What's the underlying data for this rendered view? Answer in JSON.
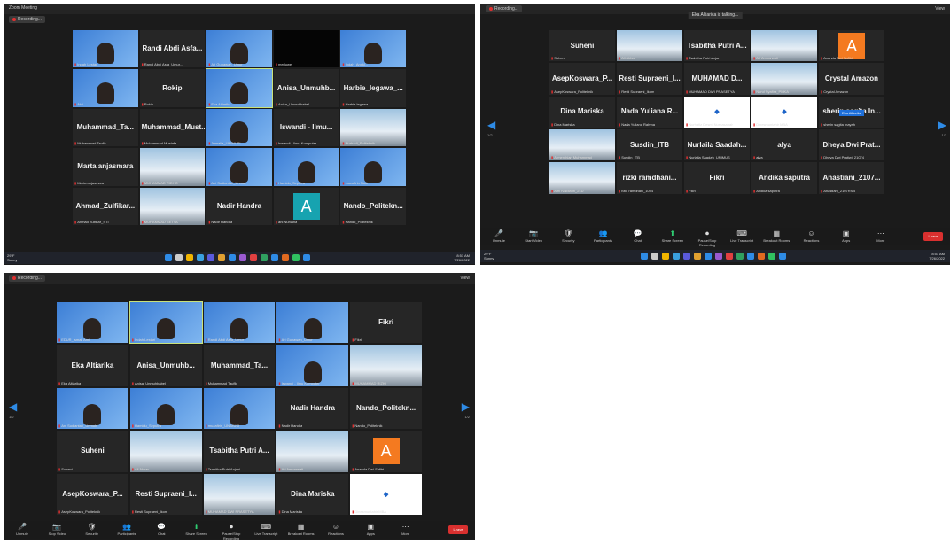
{
  "colors": {
    "accent": "#2e8be6",
    "record": "#e03030",
    "leave": "#d9302f",
    "avatar_orange": "#f47a20",
    "avatar_teal": "#17a3b0"
  },
  "screens": {
    "s1": {
      "window_title": "Zoom Meeting",
      "recording_label": "Recording...",
      "tiles": [
        {
          "name": "",
          "label": "Indah Lestari",
          "kind": "vid"
        },
        {
          "name": "Randi Abdi Asfa...",
          "label": "Randi Abdi Asfa_Umur...",
          "kind": "name"
        },
        {
          "name": "",
          "label": "Ari Gunawan_Umur",
          "kind": "vid"
        },
        {
          "name": "",
          "label": "meduwer",
          "kind": "black"
        },
        {
          "name": "",
          "label": "Indah_Angkl...",
          "kind": "vid"
        },
        {
          "name": "",
          "label": "Alvi",
          "kind": "vid"
        },
        {
          "name": "Rokip",
          "label": "Rokip",
          "kind": "name"
        },
        {
          "name": "",
          "label": "Eka Altiarika",
          "kind": "vid",
          "hl": true
        },
        {
          "name": "Anisa_Unmuhb...",
          "label": "Anisa_Unmuhbabel",
          "kind": "name"
        },
        {
          "name": "Harbie_legawa_...",
          "label": "Harbie legawa",
          "kind": "name"
        },
        {
          "name": "Muhammad_Ta...",
          "label": "Muhammad Taufik",
          "kind": "name"
        },
        {
          "name": "Muhammad_Must...",
          "label": "Muhammad Mustafa",
          "kind": "name"
        },
        {
          "name": "",
          "label": "Jurnalia_UNIMUSI",
          "kind": "vid"
        },
        {
          "name": "Iswandi - Ilmu...",
          "label": "Iswandi - Ilmu Komputer",
          "kind": "name"
        },
        {
          "name": "",
          "label": "Nurhadi_Politeknik",
          "kind": "photo"
        },
        {
          "name": "Marta anjasmara",
          "label": "Marta anjasmara",
          "kind": "name"
        },
        {
          "name": "",
          "label": "MUHAMMAD RIDHO",
          "kind": "photo"
        },
        {
          "name": "",
          "label": "Ani Sudiantari_Unmuh",
          "kind": "vid"
        },
        {
          "name": "",
          "label": "Hamidu_Seputra",
          "kind": "vid"
        },
        {
          "name": "",
          "label": "muzafirin Noor",
          "kind": "vid"
        },
        {
          "name": "Ahmad_Zulfikar...",
          "label": "Ahmad Zulfikar_STI",
          "kind": "name"
        },
        {
          "name": "",
          "label": "MUHAMMAD SETYA",
          "kind": "photo"
        },
        {
          "name": "Nadir Handra",
          "label": "Nadir Handra",
          "kind": "name"
        },
        {
          "name": "A",
          "label": "ani Nurliana",
          "kind": "avatar_teal"
        },
        {
          "name": "Nando_Politekn...",
          "label": "Nando_Politeknik",
          "kind": "name"
        }
      ],
      "weather": {
        "temp": "29°F",
        "desc": "Sunny"
      },
      "clock": {
        "time": "8:51 AM",
        "date": "7/26/2022"
      }
    },
    "s2": {
      "recording_label": "Recording...",
      "title": "Eka Altiarika is talking...",
      "view_label": "View",
      "page": "1/2",
      "chip": "Eka Altiarika",
      "tiles": [
        {
          "name": "Suheni",
          "label": "Suheni",
          "kind": "name"
        },
        {
          "name": "",
          "label": "Ali Akbar",
          "kind": "photo"
        },
        {
          "name": "Tsabitha Putri A...",
          "label": "Tsabitha Putri Anjani",
          "kind": "name"
        },
        {
          "name": "",
          "label": "Ari Ambarwati",
          "kind": "photo"
        },
        {
          "name": "A",
          "label": "Ananda Dwi Safitri",
          "kind": "avatar_orange"
        },
        {
          "name": "AsepKoswara_P...",
          "label": "AsepKoswara_Politeknik",
          "kind": "name"
        },
        {
          "name": "Resti Supraeni_I...",
          "label": "Resti Supraeni_Ikom",
          "kind": "name"
        },
        {
          "name": "MUHAMAD D...",
          "label": "MUHAMAD DWI PRASETYA",
          "kind": "name"
        },
        {
          "name": "",
          "label": "Nurul Syafira_PMKA",
          "kind": "photo"
        },
        {
          "name": "Crystal Amazon",
          "label": "Crystal Amazon",
          "kind": "name"
        },
        {
          "name": "Dina Mariska",
          "label": "Dina Mariska",
          "kind": "name"
        },
        {
          "name": "Nada Yuliana R...",
          "label": "Nada Yuliana Rahma",
          "kind": "name"
        },
        {
          "name": "",
          "label": "Nurhafiz Desmi Nurhasanah",
          "kind": "logo"
        },
        {
          "name": "",
          "label": "Dinesmuntahir MBA",
          "kind": "logo"
        },
        {
          "name": "sherin sagita In...",
          "label": "sherin sagita Inayah",
          "kind": "name"
        },
        {
          "name": "",
          "label": "Armenthian Muhammad",
          "kind": "photo"
        },
        {
          "name": "Susdin_ITB",
          "label": "Susdin_ITB",
          "kind": "name"
        },
        {
          "name": "Nurlaila Saadah...",
          "label": "Nurlaila Saadah_UNIMUS",
          "kind": "name"
        },
        {
          "name": "alya",
          "label": "alya",
          "kind": "name"
        },
        {
          "name": "Dheya Dwi Prat...",
          "label": "Dheya Dwi Pratiwi_21074",
          "kind": "name"
        },
        {
          "name": "",
          "label": "Ami Ivaldianti_21D",
          "kind": "photo"
        },
        {
          "name": "rizki ramdhani...",
          "label": "rizki ramdhani_1004",
          "kind": "name"
        },
        {
          "name": "Fikri",
          "label": "Fikri",
          "kind": "name"
        },
        {
          "name": "Andika saputra",
          "label": "Andika saputra",
          "kind": "name"
        },
        {
          "name": "Anastiani_2107...",
          "label": "Anastiani_2107RSB",
          "kind": "name"
        }
      ],
      "toolbar": [
        "Unmute",
        "Start Video",
        "Security",
        "Participants",
        "Chat",
        "Share Screen",
        "Pause/Stop Recording",
        "Live Transcript",
        "Breakout Rooms",
        "Reactions",
        "Apps",
        "More"
      ],
      "leave": "Leave",
      "weather": {
        "temp": "29°F",
        "desc": "Sunny"
      },
      "clock": {
        "time": "8:51 AM",
        "date": "7/26/2022"
      }
    },
    "s3": {
      "recording_label": "Recording...",
      "view_label": "View",
      "page": "1/2",
      "tiles": [
        {
          "name": "",
          "label": "EDUR_Ismail Amir",
          "kind": "vid"
        },
        {
          "name": "",
          "label": "Indah Lestari",
          "kind": "vid",
          "hl": true
        },
        {
          "name": "",
          "label": "Randi Abdi Asfa_Umur",
          "kind": "vid"
        },
        {
          "name": "",
          "label": "Ari Gunawan_Umur",
          "kind": "vid"
        },
        {
          "name": "Fikri",
          "label": "Fikri",
          "kind": "name"
        },
        {
          "name": "Eka Altiarika",
          "label": "Eka Altiarika",
          "kind": "name"
        },
        {
          "name": "Anisa_Unmuhb...",
          "label": "Anisa_Unmuhbabel",
          "kind": "name"
        },
        {
          "name": "Muhammad_Ta...",
          "label": "Muhammad Taufik",
          "kind": "name"
        },
        {
          "name": "",
          "label": "Iswandi - Ilmu Komputer",
          "kind": "vid"
        },
        {
          "name": "",
          "label": "MUHAMMAD RIZKI",
          "kind": "photo"
        },
        {
          "name": "",
          "label": "Ani Sudiantari_Unmuh",
          "kind": "vid"
        },
        {
          "name": "",
          "label": "Hamidu_Seputra",
          "kind": "vid"
        },
        {
          "name": "",
          "label": "muzafirin_UNIMUSI",
          "kind": "vid"
        },
        {
          "name": "Nadir Handra",
          "label": "Nadir Handra",
          "kind": "name"
        },
        {
          "name": "Nando_Politekn...",
          "label": "Nando_Politeknik",
          "kind": "name"
        },
        {
          "name": "Suheni",
          "label": "Suheni",
          "kind": "name"
        },
        {
          "name": "",
          "label": "Ali Akbar",
          "kind": "photo"
        },
        {
          "name": "Tsabitha Putri A...",
          "label": "Tsabitha Putri Anjani",
          "kind": "name"
        },
        {
          "name": "",
          "label": "Ari Ambarwati",
          "kind": "photo"
        },
        {
          "name": "A",
          "label": "Ananda Dwi Safitri",
          "kind": "avatar_orange"
        },
        {
          "name": "AsepKoswara_P...",
          "label": "AsepKoswara_Politeknik",
          "kind": "name"
        },
        {
          "name": "Resti Supraeni_I...",
          "label": "Resti Supraeni_Ikom",
          "kind": "name"
        },
        {
          "name": "",
          "label": "MUHAMAD DWI PRASETYA",
          "kind": "photo"
        },
        {
          "name": "Dina Mariska",
          "label": "Dina Mariska",
          "kind": "name"
        },
        {
          "name": "",
          "label": "Dinesmuntahir MBA",
          "kind": "logo"
        }
      ],
      "toolbar": [
        "Unmute",
        "Stop Video",
        "Security",
        "Participants",
        "Chat",
        "Share Screen",
        "Pause/Stop Recording",
        "Live Transcript",
        "Breakout Rooms",
        "Reactions",
        "Apps",
        "More"
      ],
      "leave": "Leave"
    }
  }
}
